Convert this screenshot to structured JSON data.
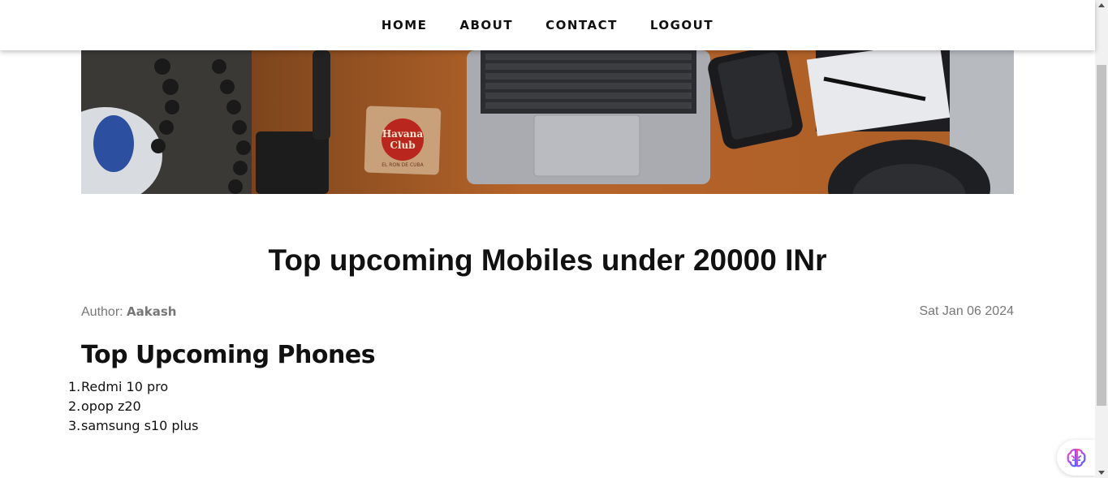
{
  "nav": {
    "items": [
      {
        "label": "HOME"
      },
      {
        "label": "ABOUT"
      },
      {
        "label": "CONTACT"
      },
      {
        "label": "LOGOUT"
      }
    ]
  },
  "hero": {
    "logo_text_line1": "Havana",
    "logo_text_line2": "Club",
    "logo_text_line3": "EL RON DE CUBA"
  },
  "post": {
    "title": "Top upcoming Mobiles under 20000 INr",
    "author_label": "Author:",
    "author_name": "Aakash",
    "date": "Sat Jan 06 2024",
    "section_heading": "Top Upcoming Phones",
    "phones": [
      {
        "num": "1.",
        "name": "Redmi 10 pro"
      },
      {
        "num": "2.",
        "name": "opop z20"
      },
      {
        "num": "3.",
        "name": "samsung s10 plus"
      }
    ]
  },
  "widget": {
    "icon": "brain-icon"
  },
  "colors": {
    "nav_text": "#111111",
    "meta_text": "#777777",
    "desk_orange": "#c06a2c"
  }
}
